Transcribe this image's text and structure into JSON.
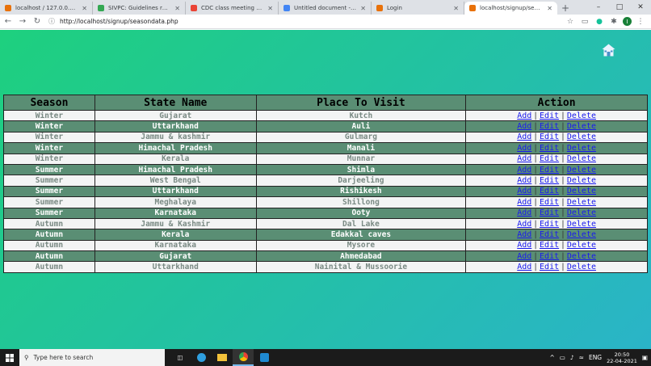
{
  "browser": {
    "tabs": [
      {
        "label": "localhost / 127.0.0.1 / test1 /",
        "color": "#e8710a"
      },
      {
        "label": "SIVPC: Guidelines regarding",
        "color": "#34a853"
      },
      {
        "label": "CDC class meeting details 2",
        "color": "#ea4335"
      },
      {
        "label": "Untitled document - Google",
        "color": "#4285f4"
      },
      {
        "label": "Login",
        "color": "#e8710a"
      },
      {
        "label": "localhost/signup/seasondat",
        "color": "#e8710a"
      }
    ],
    "url": "http://localhost/signup/seasondata.php",
    "profile_initial": "I"
  },
  "table": {
    "headers": [
      "Season",
      "State Name",
      "Place To Visit",
      "Action"
    ],
    "actions": {
      "add": "Add",
      "edit": "Edit",
      "delete": "Delete",
      "sep": "|"
    },
    "rows": [
      {
        "season": "Winter",
        "state": "Gujarat",
        "place": "Kutch"
      },
      {
        "season": "Winter",
        "state": "Uttarkhand",
        "place": "Auli"
      },
      {
        "season": "Winter",
        "state": "Jammu & kashmir",
        "place": "Gulmarg"
      },
      {
        "season": "Winter",
        "state": "Himachal Pradesh",
        "place": "Manali"
      },
      {
        "season": "Winter",
        "state": "Kerala",
        "place": "Munnar"
      },
      {
        "season": "Summer",
        "state": "Himachal Pradesh",
        "place": "Shimla"
      },
      {
        "season": "Summer",
        "state": "West Bengal",
        "place": "Darjeeling"
      },
      {
        "season": "Summer",
        "state": "Uttarkhand",
        "place": "Rishikesh"
      },
      {
        "season": "Summer",
        "state": "Meghalaya",
        "place": "Shillong"
      },
      {
        "season": "Summer",
        "state": "Karnataka",
        "place": "Ooty"
      },
      {
        "season": "Autumn",
        "state": "Jammu & Kashmir",
        "place": "Dal Lake"
      },
      {
        "season": "Autumn",
        "state": "Kerala",
        "place": "Edakkal caves"
      },
      {
        "season": "Autumn",
        "state": "Karnataka",
        "place": "Mysore"
      },
      {
        "season": "Autumn",
        "state": "Gujarat",
        "place": "Ahmedabad"
      },
      {
        "season": "Autumn",
        "state": "Uttarkhand",
        "place": "Nainital & Mussoorie"
      }
    ]
  },
  "taskbar": {
    "search_placeholder": "Type here to search",
    "lang": "ENG",
    "time": "20:50",
    "date": "22-04-2021"
  },
  "colors": {
    "header_bg": "#5a8e74",
    "link": "#1a1aee",
    "gradient_start": "#1ed07e",
    "gradient_end": "#2ab4c8"
  }
}
